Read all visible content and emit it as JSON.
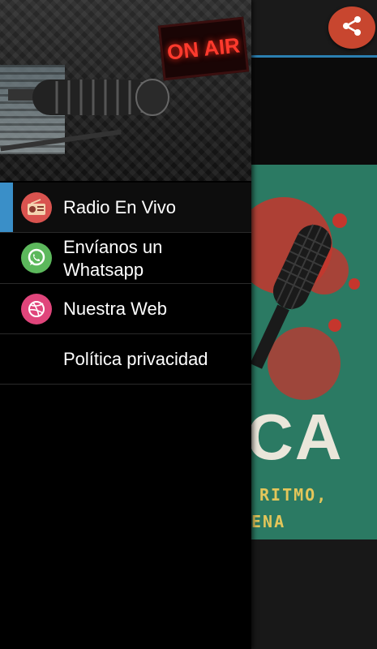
{
  "drawer": {
    "header": {
      "sign_text": "ON AIR"
    },
    "items": [
      {
        "label": "Radio En Vivo",
        "icon": "radio-icon",
        "active": true
      },
      {
        "label": "Envíanos un Whatsapp",
        "icon": "whatsapp-icon",
        "active": false
      },
      {
        "label": "Nuestra Web",
        "icon": "dribbble-icon",
        "active": false
      },
      {
        "label": "Política privacidad",
        "icon": "",
        "active": false
      }
    ]
  },
  "background": {
    "cover_big_text": "CA",
    "cover_line1": "RITMO,",
    "cover_line2": "ENA"
  },
  "colors": {
    "accent": "#3a8fc8",
    "share_button": "#c8462f",
    "radio_icon_bg": "#d9534f",
    "whatsapp_icon_bg": "#5cb85c",
    "web_icon_bg": "#e0457b",
    "cover_bg": "#2b7a63"
  }
}
